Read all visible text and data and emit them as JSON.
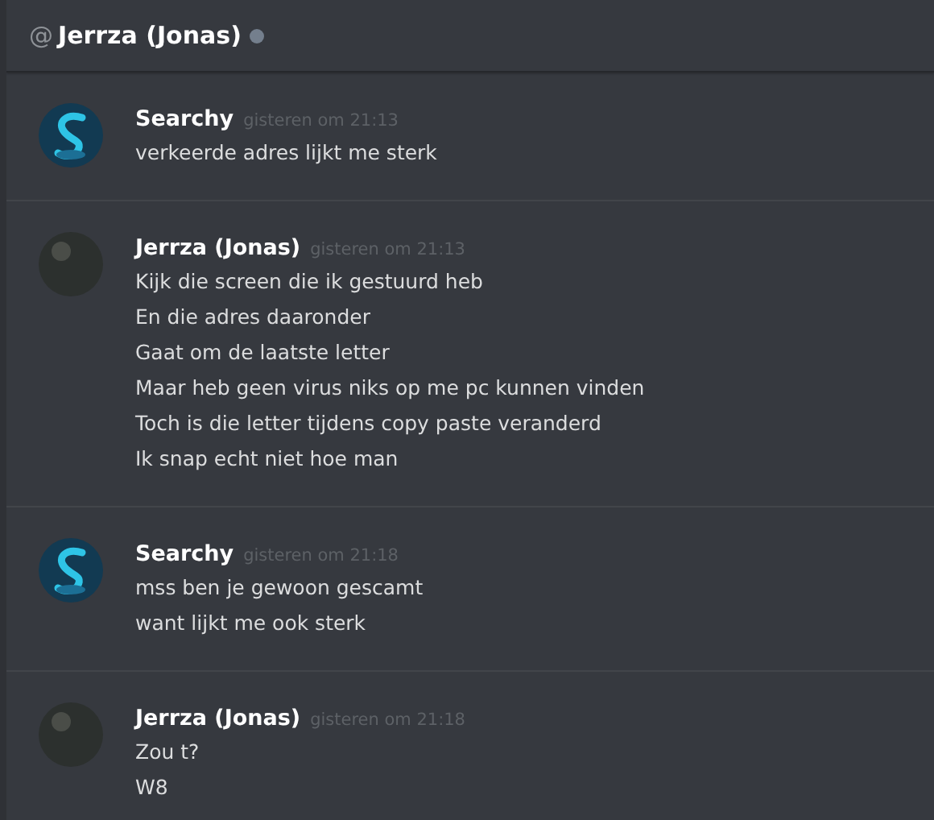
{
  "header": {
    "at_sign": "@",
    "title": "Jerrza (Jonas)",
    "online": false
  },
  "messages": [
    {
      "author": "Searchy",
      "kind": "logo",
      "timestamp": "gisteren om 21:13",
      "lines": [
        "verkeerde adres lijkt me sterk"
      ]
    },
    {
      "author": "Jerrza (Jonas)",
      "kind": "photo",
      "timestamp": "gisteren om 21:13",
      "lines": [
        "Kijk die screen die ik gestuurd heb",
        "En die adres daaronder",
        "Gaat om de laatste letter",
        "Maar heb geen virus niks op me pc kunnen vinden",
        "Toch is die letter tijdens copy paste veranderd",
        "Ik snap echt niet hoe man"
      ]
    },
    {
      "author": "Searchy",
      "kind": "logo",
      "timestamp": "gisteren om 21:18",
      "lines": [
        "mss ben je gewoon gescamt",
        "want lijkt me ook sterk"
      ]
    },
    {
      "author": "Jerrza (Jonas)",
      "kind": "photo",
      "timestamp": "gisteren om 21:18",
      "lines": [
        "Zou t?",
        "W8"
      ]
    }
  ]
}
